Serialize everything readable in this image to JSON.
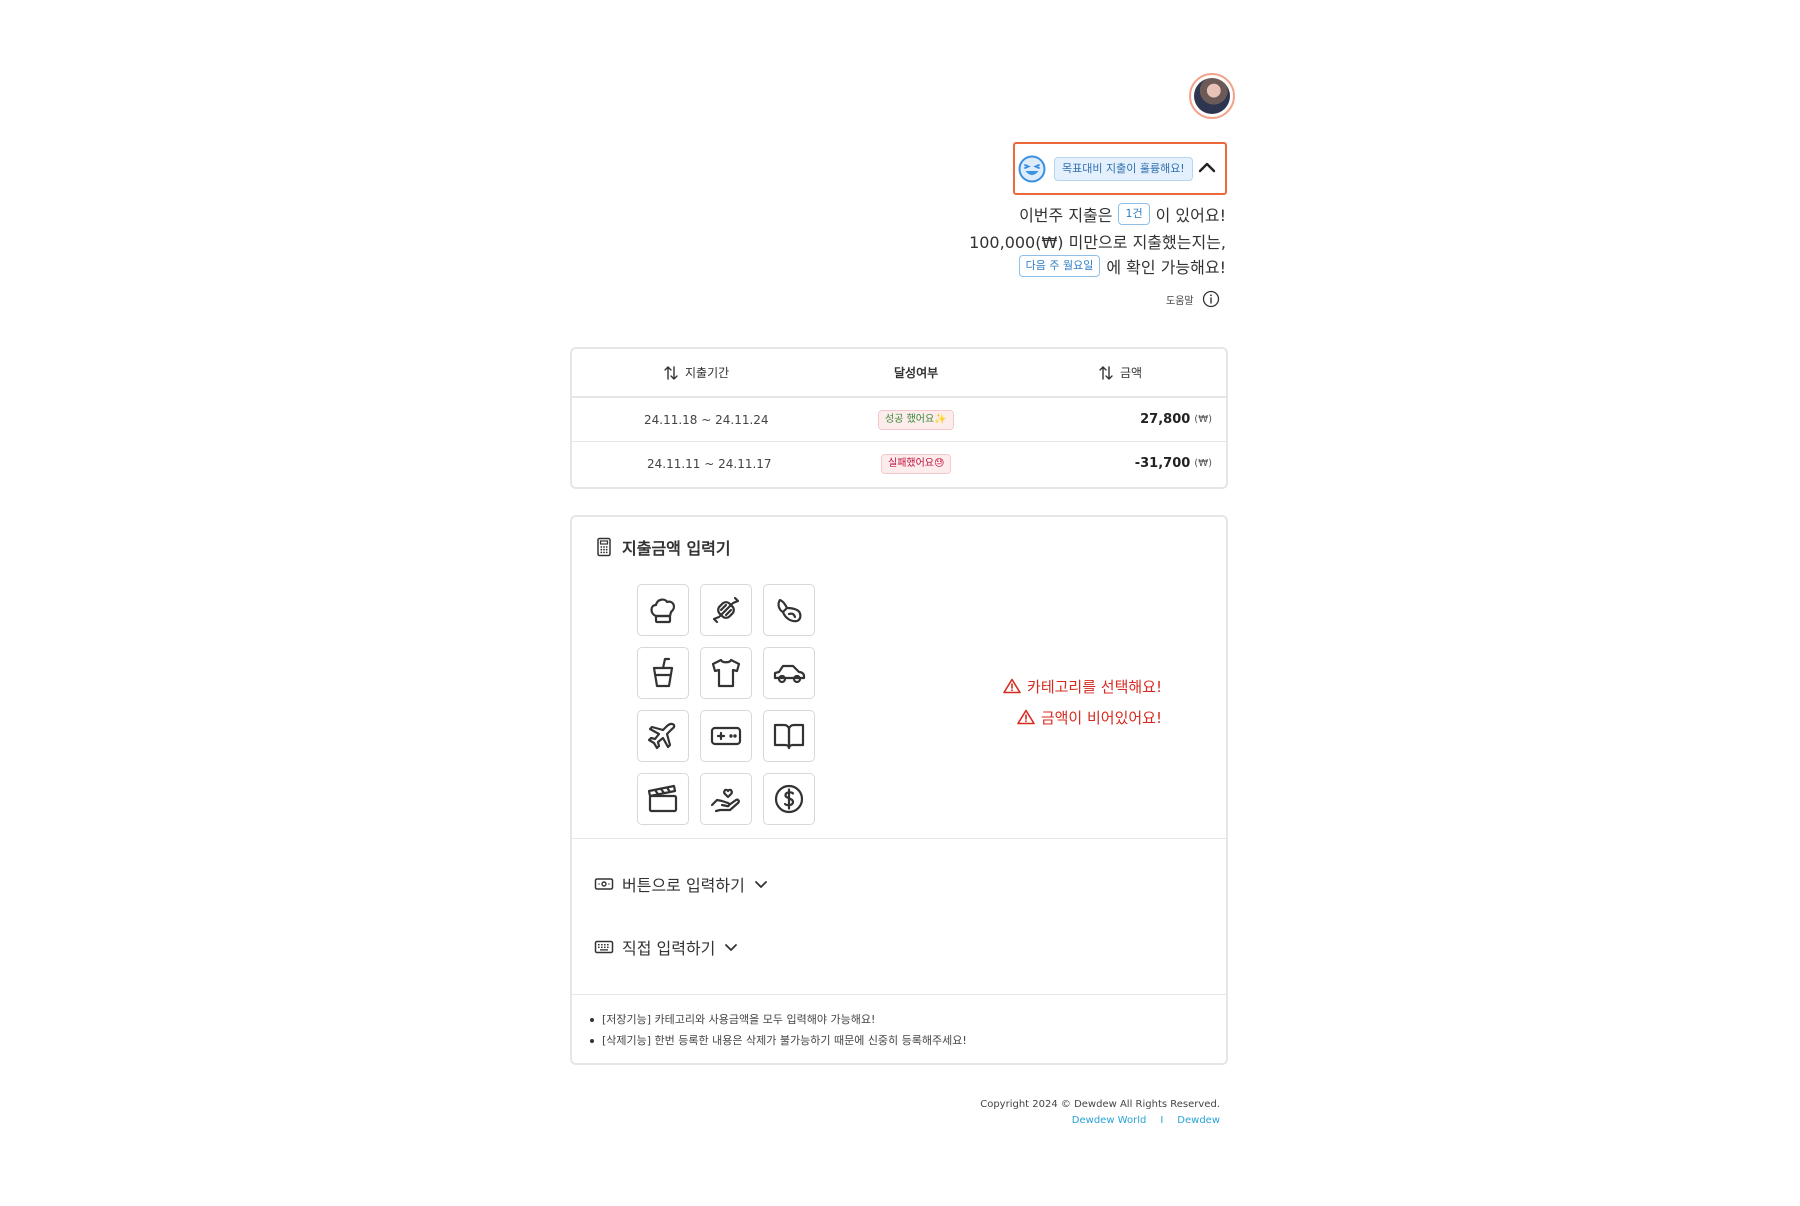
{
  "status": {
    "message": "목표대비 지출이 훌륭해요!"
  },
  "summary": {
    "prefix": "이번주 지출은",
    "count_chip": "1건",
    "suffix": "이 있어요!",
    "threshold_line": "100,000(₩) 미만으로 지출했는지는,",
    "day_chip": "다음 주 월요일",
    "check_suffix": "에 확인 가능해요!"
  },
  "help": {
    "label": "도움말"
  },
  "history": {
    "columns": {
      "period": "지출기간",
      "result": "달성여부",
      "amount": "금액"
    },
    "rows": [
      {
        "period": "24.11.18 ~ 24.11.24",
        "result": "성공 했어요✨",
        "amount": "27,800",
        "unit": "(₩)"
      },
      {
        "period": "24.11.11 ~ 24.11.17",
        "result": "실패했어요😓",
        "amount": "-31,700",
        "unit": "(₩)"
      }
    ]
  },
  "input_panel": {
    "title": "지출금액 입력기",
    "categories": [
      "chef-hat-icon",
      "candy-icon",
      "croissant-icon",
      "drink-cup-icon",
      "shirt-icon",
      "car-icon",
      "airplane-icon",
      "gamepad-icon",
      "book-icon",
      "clapperboard-icon",
      "heart-hand-icon",
      "dollar-coin-icon"
    ],
    "errors": {
      "category": "카테고리를 선택해요!",
      "amount": "금액이 비어있어요!"
    },
    "button_input_label": "버튼으로 입력하기",
    "direct_input_label": "직접 입력하기",
    "notes": [
      "[저장기능] 카테고리와 사용금액을 모두 입력해야 가능해요!",
      "[삭제기능] 한번 등록한 내용은 삭제가 불가능하기 때문에 신중히 등록해주세요!"
    ]
  },
  "footer": {
    "copyright": "Copyright 2024 © Dewdew All Rights Reserved.",
    "link1": "Dewdew World",
    "separator": "I",
    "link2": "Dewdew"
  },
  "colors": {
    "accent": "#ec6a3a",
    "error": "#d62b20",
    "link": "#29a3d6",
    "chip": "#2f7ec4"
  }
}
